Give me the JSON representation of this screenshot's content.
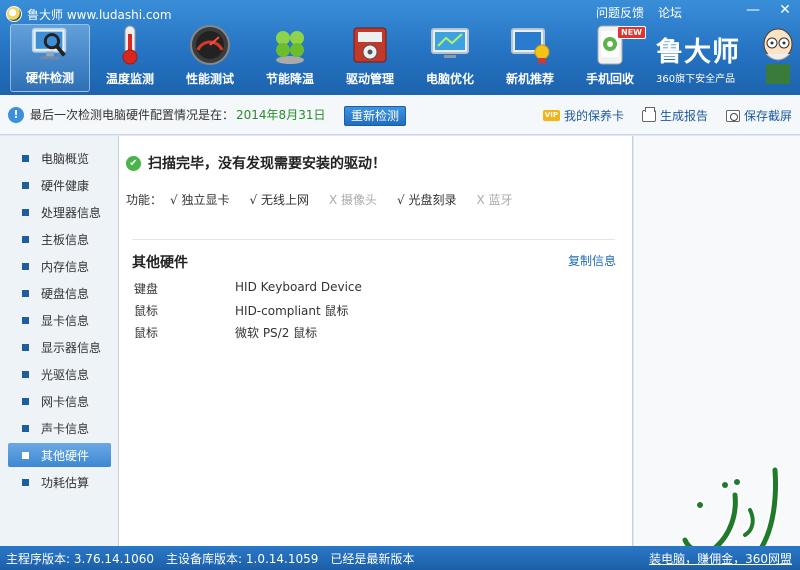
{
  "app": {
    "title": "鲁大师 www.ludashi.com",
    "links": [
      "问题反馈",
      "论坛"
    ],
    "window_buttons": {
      "minimize": "—",
      "close": "✕"
    }
  },
  "toolbar": {
    "items": [
      {
        "label": "硬件检测",
        "icon": "monitor-magnifier-icon",
        "active": true
      },
      {
        "label": "温度监测",
        "icon": "thermometer-icon"
      },
      {
        "label": "性能测试",
        "icon": "speedometer-icon"
      },
      {
        "label": "节能降温",
        "icon": "clover-icon"
      },
      {
        "label": "驱动管理",
        "icon": "gear-box-icon"
      },
      {
        "label": "电脑优化",
        "icon": "optimize-monitor-icon"
      },
      {
        "label": "新机推荐",
        "icon": "new-pc-icon"
      },
      {
        "label": "手机回收",
        "icon": "phone-recycle-icon",
        "badge": "NEW"
      }
    ]
  },
  "brand": {
    "name": "鲁大师",
    "subtitle": "360旗下安全产品"
  },
  "infobar": {
    "text": "最后一次检测电脑硬件配置情况是在：",
    "date": "2014年8月31日",
    "rescan": "重新检测",
    "vip": "VIP",
    "links": [
      "我的保养卡",
      "生成报告",
      "保存截屏"
    ]
  },
  "sidebar": {
    "items": [
      "电脑概览",
      "硬件健康",
      "处理器信息",
      "主板信息",
      "内存信息",
      "硬盘信息",
      "显卡信息",
      "显示器信息",
      "光驱信息",
      "网卡信息",
      "声卡信息",
      "其他硬件",
      "功耗估算"
    ],
    "active": "其他硬件"
  },
  "main": {
    "scan_result": "扫描完毕，没有发现需要安装的驱动！",
    "features_label": "功能：",
    "features": [
      {
        "label": "√ 独立显卡",
        "enabled": true
      },
      {
        "label": "√ 无线上网",
        "enabled": true
      },
      {
        "label": "X 摄像头",
        "enabled": false
      },
      {
        "label": "√ 光盘刻录",
        "enabled": true
      },
      {
        "label": "X 蓝牙",
        "enabled": false
      }
    ],
    "section_title": "其他硬件",
    "copy_info": "复制信息",
    "hardware": [
      {
        "type": "键盘",
        "name": "HID Keyboard Device"
      },
      {
        "type": "鼠标",
        "name": "HID-compliant 鼠标"
      },
      {
        "type": "鼠标",
        "name": "微软 PS/2 鼠标"
      }
    ]
  },
  "statusbar": {
    "main_version": "主程序版本: 3.76.14.1060",
    "db_version": "主设备库版本: 1.0.14.1059",
    "status": "已经是最新版本",
    "link": "装电脑，赚佣金，360网盟"
  },
  "colors": {
    "header_blue": "#2573c2",
    "date_green": "#2a8a2a",
    "link_blue": "#1e6bb8",
    "check_green": "#4ab34a"
  }
}
